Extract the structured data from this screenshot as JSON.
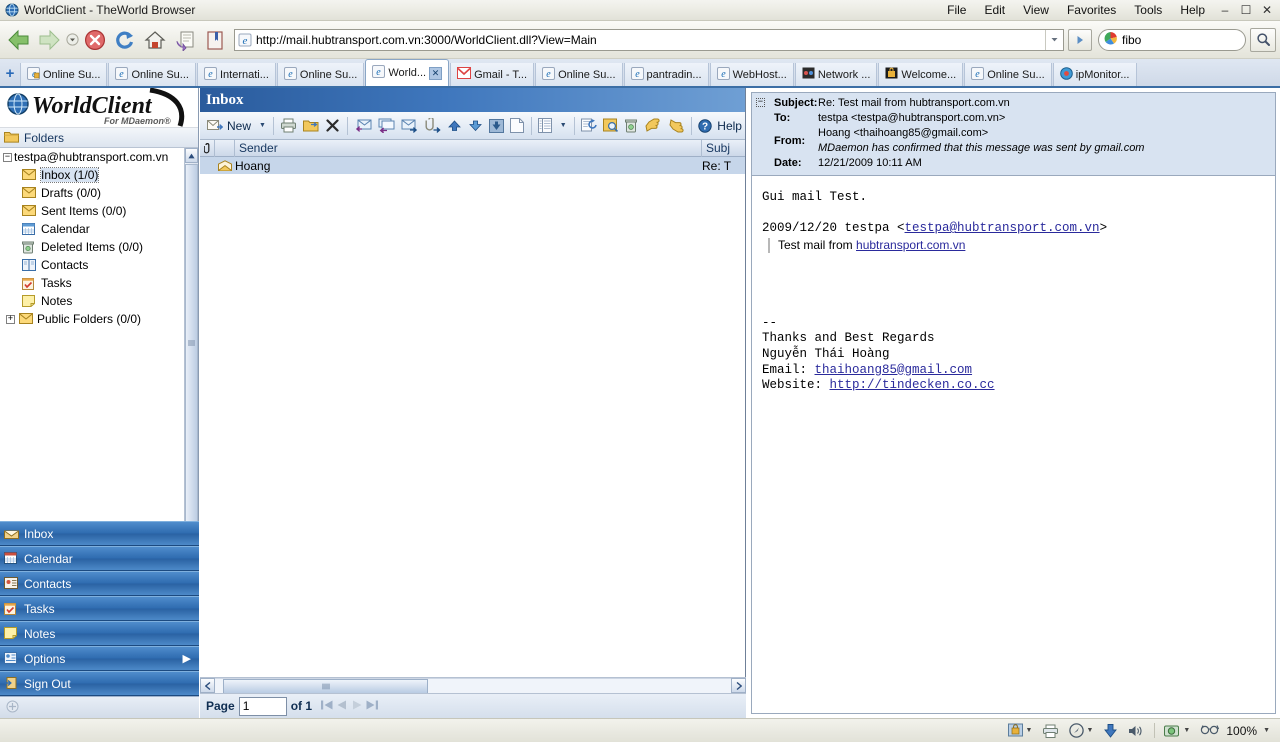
{
  "window": {
    "title": "WorldClient - TheWorld Browser",
    "icon": "globe-icon",
    "menus": [
      "File",
      "Edit",
      "View",
      "Favorites",
      "Tools",
      "Help"
    ],
    "buttons": {
      "minimize": "–",
      "maximize": "☐",
      "close": "✕"
    }
  },
  "navbar": {
    "back": "back-icon",
    "forward": "forward-icon",
    "history_dropdown": "chevron-down-icon",
    "stop": "stop-icon",
    "refresh": "refresh-icon",
    "home": "home-icon",
    "saveoffline": "save-page-icon",
    "bookmarks": "bookmarks-icon",
    "url": "http://mail.hubtransport.com.vn:3000/WorldClient.dll?View=Main",
    "url_placeholder": "Address",
    "go_label": "▶",
    "search_engine": "google-icon",
    "search_value": "fibo",
    "search_placeholder": "Search",
    "search_button": "search-icon"
  },
  "tabs": {
    "new_tab_label": "+",
    "items": [
      {
        "label": "Online Su...",
        "icon": "ie-lock-icon",
        "active": false,
        "closable": false
      },
      {
        "label": "Online Su...",
        "icon": "ie-icon",
        "active": false,
        "closable": false
      },
      {
        "label": "Internati...",
        "icon": "ie-icon",
        "active": false,
        "closable": false
      },
      {
        "label": "Online Su...",
        "icon": "ie-icon",
        "active": false,
        "closable": false
      },
      {
        "label": "World...",
        "icon": "ie-icon",
        "active": true,
        "closable": true,
        "close_label": "✕"
      },
      {
        "label": "Gmail - T...",
        "icon": "gmail-icon",
        "active": false,
        "closable": false
      },
      {
        "label": "Online Su...",
        "icon": "ie-icon",
        "active": false,
        "closable": false
      },
      {
        "label": "pantradin...",
        "icon": "ie-icon",
        "active": false,
        "closable": false
      },
      {
        "label": "WebHost...",
        "icon": "ie-icon",
        "active": false,
        "closable": false
      },
      {
        "label": "Network ...",
        "icon": "network-icon",
        "active": false,
        "closable": false
      },
      {
        "label": "Welcome...",
        "icon": "lock-page-icon",
        "active": false,
        "closable": false
      },
      {
        "label": "Online Su...",
        "icon": "ie-icon",
        "active": false,
        "closable": false
      },
      {
        "label": "ipMonitor...",
        "icon": "ipmonitor-icon",
        "active": false,
        "closable": false
      }
    ]
  },
  "sidebar": {
    "brand": "WorldClient",
    "brand_sub": "For MDaemon®",
    "folders_header": "Folders",
    "folders_icon": "folder-icon",
    "account": "testpa@hubtransport.com.vn",
    "account_expander": "−",
    "tree": [
      {
        "label": "Inbox (1/0)",
        "icon": "envelope-icon",
        "selected": true
      },
      {
        "label": "Drafts (0/0)",
        "icon": "envelope-icon",
        "selected": false
      },
      {
        "label": "Sent Items (0/0)",
        "icon": "envelope-icon",
        "selected": false
      },
      {
        "label": "Calendar",
        "icon": "calendar-icon",
        "selected": false
      },
      {
        "label": "Deleted Items (0/0)",
        "icon": "trash-icon",
        "selected": false
      },
      {
        "label": "Contacts",
        "icon": "contacts-icon",
        "selected": false
      },
      {
        "label": "Tasks",
        "icon": "tasks-icon",
        "selected": false
      },
      {
        "label": "Notes",
        "icon": "notes-icon",
        "selected": false
      }
    ],
    "public_folders": {
      "label": "Public Folders (0/0)",
      "icon": "envelope-icon",
      "expander": "+"
    },
    "scrollbar": {
      "up": "▲",
      "down": "▼"
    },
    "nav": [
      {
        "label": "Inbox",
        "icon": "inbox-icon",
        "arrow": ""
      },
      {
        "label": "Calendar",
        "icon": "calendar-icon",
        "arrow": ""
      },
      {
        "label": "Contacts",
        "icon": "contacts-icon",
        "arrow": ""
      },
      {
        "label": "Tasks",
        "icon": "tasks-icon",
        "arrow": ""
      },
      {
        "label": "Notes",
        "icon": "notes-icon",
        "arrow": ""
      },
      {
        "label": "Options",
        "icon": "options-icon",
        "arrow": "▶"
      },
      {
        "label": "Sign Out",
        "icon": "signout-icon",
        "arrow": ""
      }
    ]
  },
  "listpane": {
    "title": "Inbox",
    "toolbar": {
      "new_label": "New",
      "new_icon": "new-message-icon",
      "new_caret": "▼",
      "print": "print-icon",
      "move": "move-to-folder-icon",
      "delete": "delete-x-icon",
      "reply": "reply-icon",
      "reply_all": "reply-all-icon",
      "forward": "forward-mail-icon",
      "forward_attachment": "forward-as-attachment-icon",
      "move_up": "arrow-up-icon",
      "move_down": "arrow-down-icon",
      "download": "download-icon",
      "view_source": "page-icon",
      "columns": "columns-icon",
      "columns_caret": "▼",
      "refresh_list": "refresh-list-icon",
      "search": "search-mail-icon",
      "empty_trash": "trash-icon",
      "spam": "thumbs-down-icon",
      "not_spam": "thumbs-up-icon",
      "help_icon": "help-icon",
      "help_label": "Help"
    },
    "columns": [
      "",
      "",
      "Sender",
      "Subj"
    ],
    "attachment_col_icon": "paperclip-icon",
    "rows": [
      {
        "icon": "envelope-open-icon",
        "sender": "Hoang",
        "subject": "Re: T"
      }
    ],
    "hscroll": {
      "left": "‹",
      "right": "›",
      "grip": "‖"
    },
    "pager": {
      "page_label": "Page",
      "page_value": "1",
      "of_label": "of 1",
      "first": "◀❘",
      "prev": "◀",
      "next": "▶",
      "last": "❘▶"
    }
  },
  "message": {
    "collapse_toggle": "−",
    "subject_label": "Subject:",
    "subject": "Re: Test mail from hubtransport.com.vn",
    "to_label": "To:",
    "to": "testpa <testpa@hubtransport.com.vn>",
    "from_label": "From:",
    "from": "Hoang <thaihoang85@gmail.com>",
    "from_note": "MDaemon has confirmed that this message was sent by gmail.com",
    "date_label": "Date:",
    "date": "12/21/2009 10:11 AM",
    "body": {
      "line1": "Gui mail Test.",
      "line2": "2009/12/20 testpa <",
      "line2_link": "testpa@hubtransport.com.vn",
      "line2_end": ">",
      "quote_text": "Test mail from ",
      "quote_link": "hubtransport.com.vn",
      "sig_dashes": "--",
      "sig_line1": "Thanks and Best Regards",
      "sig_line2": "Nguyễn Thái Hoàng",
      "sig_email_label": "Email: ",
      "sig_email": "thaihoang85@gmail.com",
      "sig_web_label": "Website: ",
      "sig_web": "http://tindecken.co.cc"
    }
  },
  "statusbar": {
    "security_zone": "security-zone-icon",
    "security_caret": "▼",
    "printer": "printer-icon",
    "compass": "compass-icon",
    "compass_caret": "▼",
    "download": "download-arrow-icon",
    "sound": "speaker-icon",
    "proxy": "proxy-icon",
    "proxy_caret": "▼",
    "zoom_icon": "zoom-glasses-icon",
    "zoom_level": "100%",
    "zoom_caret": "▼"
  },
  "colors": {
    "accent": "#2f6cb0",
    "title_gradient_start": "#2a5b9c",
    "selection": "#c6d6ea",
    "header_panel": "#d8e3f1",
    "link": "#2a2a9c"
  }
}
